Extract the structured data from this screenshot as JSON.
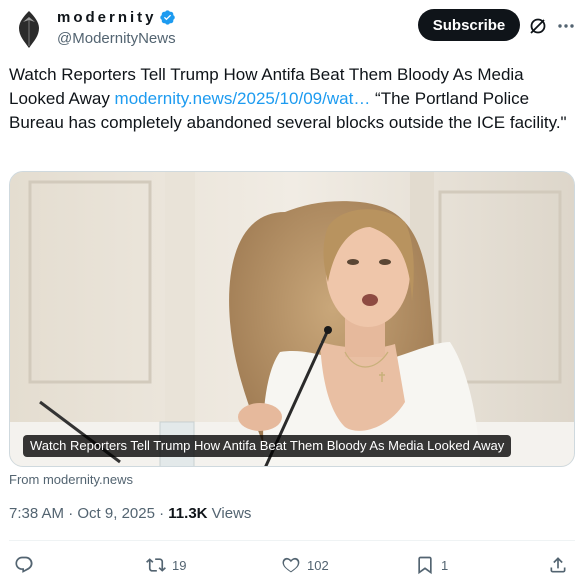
{
  "author": {
    "display_name": "modernity",
    "handle": "@ModernityNews",
    "verified": true
  },
  "header": {
    "subscribe_label": "Subscribe"
  },
  "tweet": {
    "text_before": "Watch Reporters Tell Trump How Antifa Beat Them Bloody As Media Looked Away ",
    "link_text": "modernity.news/2025/10/09/wat…",
    "text_after": " “The Portland Police Bureau has completely abandoned several blocks outside the ICE facility.\""
  },
  "media": {
    "caption": "Watch Reporters Tell Trump How Antifa Beat Them Bloody As Media Looked Away",
    "source": "From modernity.news"
  },
  "meta": {
    "time": "7:38 AM",
    "separator": "·",
    "date": "Oct 9, 2025",
    "views_count": "11.3K",
    "views_label": "Views"
  },
  "actions": {
    "replies": "",
    "reposts": "19",
    "likes": "102",
    "bookmarks": "1"
  },
  "colors": {
    "accent": "#1d9bf0",
    "text": "#0f1419",
    "secondary": "#536471",
    "button_bg": "#0f1419"
  }
}
